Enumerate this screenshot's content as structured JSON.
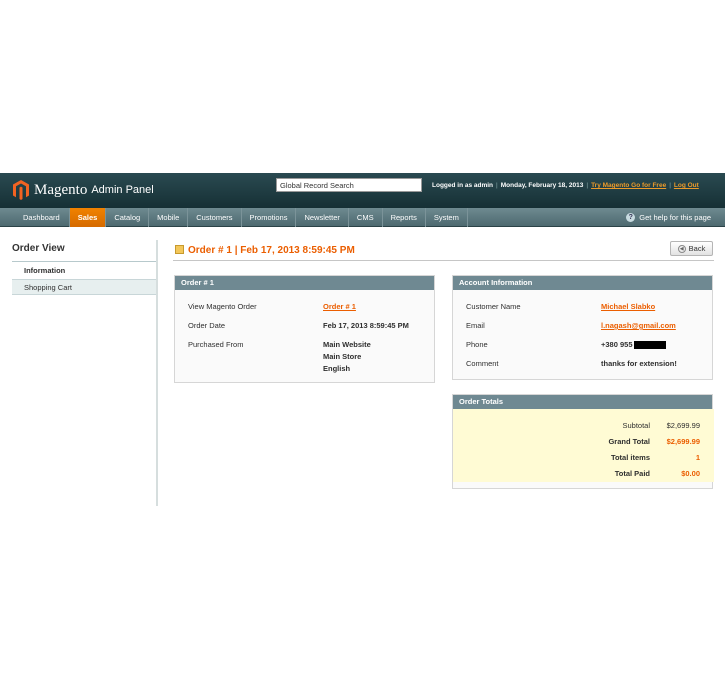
{
  "header": {
    "logo_main": "Magento",
    "logo_sub": "Admin Panel",
    "search_value": "Global Record Search",
    "logged_in": "Logged in as admin",
    "date": "Monday, February 18, 2013",
    "try_link": "Try Magento Go for Free",
    "logout": "Log Out"
  },
  "nav": {
    "items": [
      "Dashboard",
      "Sales",
      "Catalog",
      "Mobile",
      "Customers",
      "Promotions",
      "Newsletter",
      "CMS",
      "Reports",
      "System"
    ],
    "active": "Sales",
    "help": "Get help for this page"
  },
  "sidebar": {
    "title": "Order View",
    "items": [
      "Information",
      "Shopping Cart"
    ]
  },
  "page": {
    "title": "Order # 1 | Feb 17, 2013 8:59:45 PM",
    "back": "Back"
  },
  "order_box": {
    "title": "Order # 1",
    "view_label": "View Magento Order",
    "view_value": "Order # 1",
    "date_label": "Order Date",
    "date_value": "Feb 17, 2013 8:59:45 PM",
    "from_label": "Purchased From",
    "from_lines": [
      "Main Website",
      "Main Store",
      "English"
    ]
  },
  "account_box": {
    "title": "Account Information",
    "name_label": "Customer Name",
    "name_value": "Michael Slabko",
    "email_label": "Email",
    "email_value": "l.nagash@gmail.com",
    "phone_label": "Phone",
    "phone_value": "+380 955",
    "comment_label": "Comment",
    "comment_value": "thanks for extension!"
  },
  "totals_box": {
    "title": "Order Totals",
    "rows": [
      {
        "label": "Subtotal",
        "value": "$2,699.99"
      },
      {
        "label": "Grand Total",
        "value": "$2,699.99"
      },
      {
        "label": "Total items",
        "value": "1"
      },
      {
        "label": "Total Paid",
        "value": "$0.00"
      }
    ]
  },
  "colors": {
    "accent": "#eb5e00",
    "header_bg": "#1f383e",
    "nav_bg": "#5b777e",
    "box_head": "#6f8992",
    "totals_bg": "#fffbd4"
  }
}
